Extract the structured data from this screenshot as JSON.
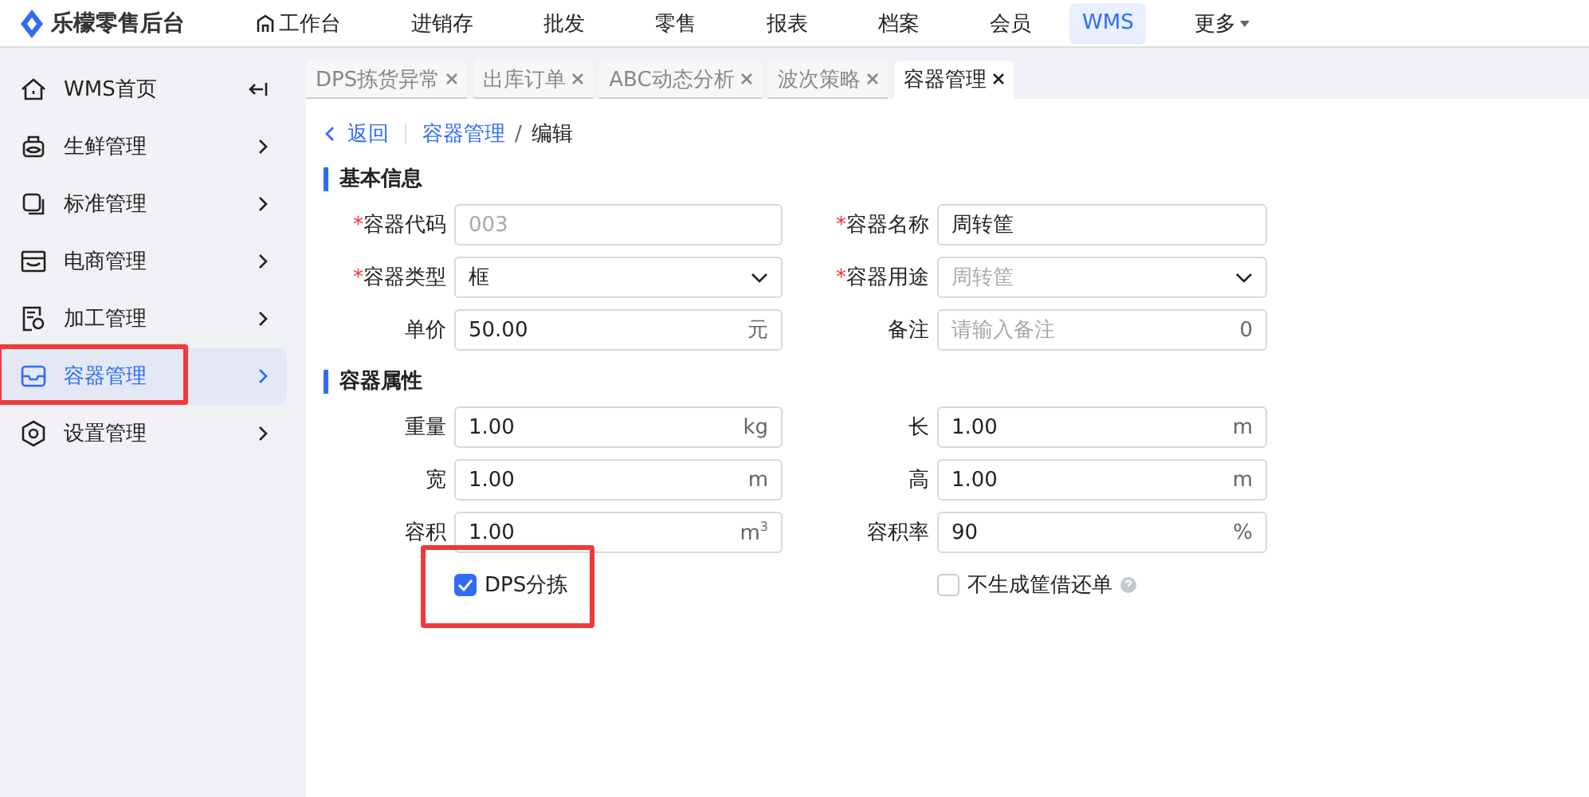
{
  "app": {
    "name": "乐檬零售后台"
  },
  "nav": [
    {
      "label": "工作台",
      "kind": "home",
      "selected": false
    },
    {
      "label": "进销存",
      "kind": "plain",
      "selected": false
    },
    {
      "label": "批发",
      "kind": "plain",
      "selected": false
    },
    {
      "label": "零售",
      "kind": "plain",
      "selected": false
    },
    {
      "label": "报表",
      "kind": "plain",
      "selected": false
    },
    {
      "label": "档案",
      "kind": "plain",
      "selected": false
    },
    {
      "label": "会员",
      "kind": "plain",
      "selected": false
    },
    {
      "label": "WMS",
      "kind": "plain",
      "selected": true
    },
    {
      "label": "更多",
      "kind": "dropdown",
      "selected": false
    }
  ],
  "sidebar": {
    "items": [
      {
        "label": "WMS首页",
        "kind": "collapse",
        "selected": false,
        "highlighted": false
      },
      {
        "label": "生鲜管理",
        "kind": "arrow",
        "selected": false,
        "highlighted": false
      },
      {
        "label": "标准管理",
        "kind": "arrow",
        "selected": false,
        "highlighted": false
      },
      {
        "label": "电商管理",
        "kind": "arrow",
        "selected": false,
        "highlighted": false
      },
      {
        "label": "加工管理",
        "kind": "arrow",
        "selected": false,
        "highlighted": false
      },
      {
        "label": "容器管理",
        "kind": "arrow",
        "selected": true,
        "highlighted": true
      },
      {
        "label": "设置管理",
        "kind": "arrow",
        "selected": false,
        "highlighted": false
      }
    ]
  },
  "tabs": [
    {
      "label": "DPS拣货异常",
      "selected": false
    },
    {
      "label": "出库订单",
      "selected": false
    },
    {
      "label": "ABC动态分析",
      "selected": false
    },
    {
      "label": "波次策略",
      "selected": false
    },
    {
      "label": "容器管理",
      "selected": true
    }
  ],
  "breadcrumb": {
    "back": "返回",
    "path": "容器管理",
    "sep": "/",
    "current": "编辑"
  },
  "sections": [
    {
      "title": "基本信息",
      "fields": [
        {
          "mark": "*",
          "label": "容器代码",
          "kind": "input",
          "value": "003",
          "disabled": true
        },
        {
          "mark": "*",
          "label": "容器名称",
          "kind": "input",
          "value": "周转筐",
          "disabled": false
        },
        {
          "mark": "*",
          "label": "容器类型",
          "kind": "select",
          "value": "框",
          "disabled": false
        },
        {
          "mark": "*",
          "label": "容器用途",
          "kind": "select",
          "value": "周转筐",
          "disabled": true
        },
        {
          "label": "单价",
          "kind": "input",
          "value": "50.00",
          "suffix": "元",
          "disabled": false
        },
        {
          "label": "备注",
          "kind": "input",
          "placeholder": "请输入备注",
          "suffix": "0"
        }
      ]
    },
    {
      "title": "容器属性",
      "fields": [
        {
          "label": "重量",
          "kind": "input",
          "value": "1.00",
          "suffix": "kg",
          "disabled": false
        },
        {
          "label": "长",
          "kind": "input",
          "value": "1.00",
          "suffix": "m",
          "disabled": false
        },
        {
          "label": "宽",
          "kind": "input",
          "value": "1.00",
          "suffix": "m",
          "disabled": false
        },
        {
          "label": "高",
          "kind": "input",
          "value": "1.00",
          "suffix": "m",
          "disabled": false
        },
        {
          "label": "容积",
          "kind": "input",
          "value": "1.00",
          "suffix": "m$^{3}$",
          "disabled": false
        },
        {
          "label": "容积率",
          "kind": "input",
          "value": "90",
          "suffix": "%",
          "disabled": false
        }
      ],
      "checkboxes": [
        {
          "label": "DPS分拣",
          "checked": true,
          "highlighted": true,
          "help": false
        },
        {
          "label": "不生成筐借还单",
          "checked": false,
          "highlighted": false,
          "help": true
        }
      ]
    }
  ]
}
